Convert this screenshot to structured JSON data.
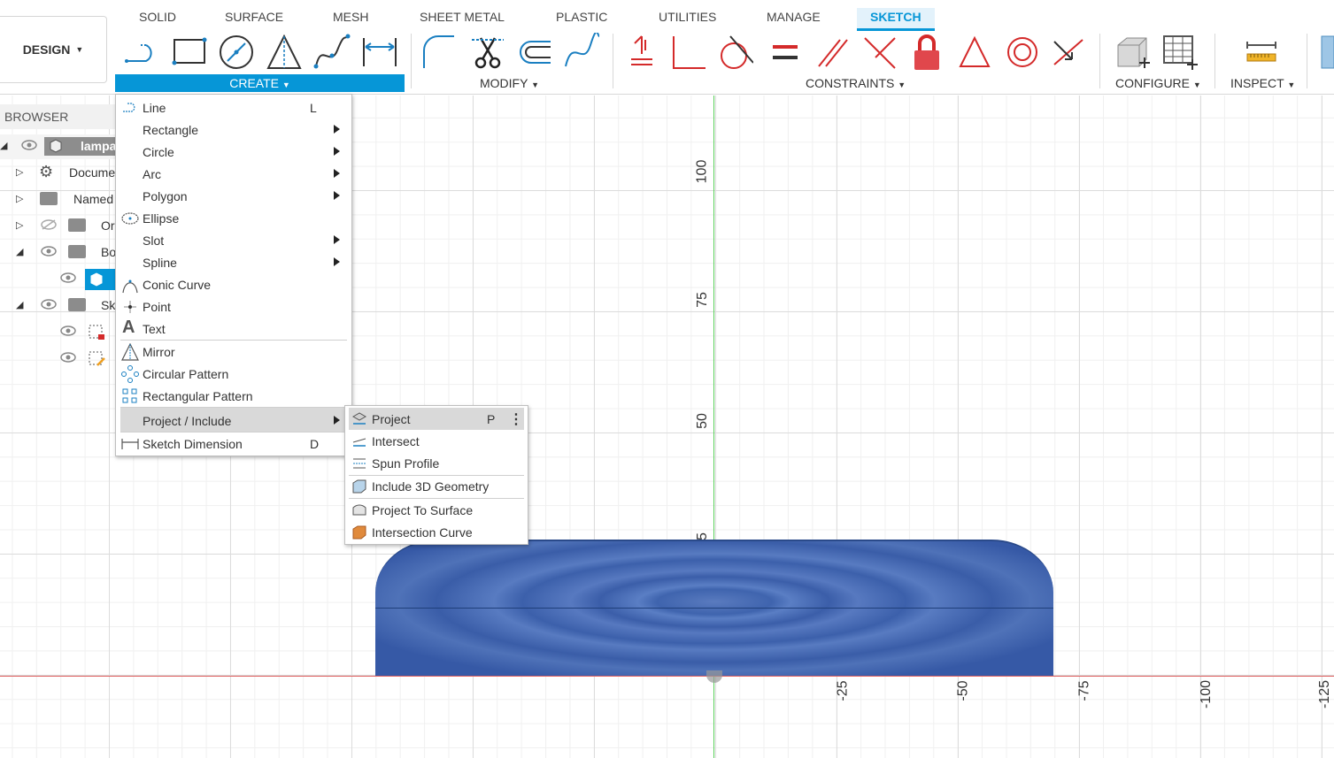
{
  "workspace": {
    "label": "DESIGN"
  },
  "tabs": [
    "SOLID",
    "SURFACE",
    "MESH",
    "SHEET METAL",
    "PLASTIC",
    "UTILITIES",
    "MANAGE",
    "SKETCH"
  ],
  "active_tab": "SKETCH",
  "groups": {
    "create": "CREATE",
    "modify": "MODIFY",
    "constraints": "CONSTRAINTS",
    "configure": "CONFIGURE",
    "inspect": "INSPECT"
  },
  "browser": {
    "title": "BROWSER",
    "rows": [
      "lampa",
      "Docume",
      "Named",
      "Or",
      "Bo",
      "",
      "Sk",
      "",
      ""
    ]
  },
  "create_menu": {
    "items": [
      {
        "label": "Line",
        "shortcut": "L"
      },
      {
        "label": "Rectangle"
      },
      {
        "label": "Circle"
      },
      {
        "label": "Arc"
      },
      {
        "label": "Polygon"
      },
      {
        "label": "Ellipse"
      },
      {
        "label": "Slot"
      },
      {
        "label": "Spline"
      },
      {
        "label": "Conic Curve"
      },
      {
        "label": "Point"
      },
      {
        "label": "Text"
      },
      {
        "label": "Mirror"
      },
      {
        "label": "Circular Pattern"
      },
      {
        "label": "Rectangular Pattern"
      },
      {
        "label": "Project / Include"
      },
      {
        "label": "Sketch Dimension",
        "shortcut": "D"
      }
    ]
  },
  "project_menu": {
    "items": [
      {
        "label": "Project",
        "shortcut": "P"
      },
      {
        "label": "Intersect"
      },
      {
        "label": "Spun Profile"
      },
      {
        "label": "Include 3D Geometry"
      },
      {
        "label": "Project To Surface"
      },
      {
        "label": "Intersection Curve"
      }
    ]
  },
  "canvas": {
    "v_ticks": [
      "100",
      "75",
      "50",
      "25"
    ],
    "h_ticks": [
      "-25",
      "-50",
      "-75",
      "-100",
      "-125"
    ]
  },
  "colors": {
    "accent": "#0696d7",
    "body": "#3f64ae",
    "constraint_red": "#d42a2a"
  }
}
